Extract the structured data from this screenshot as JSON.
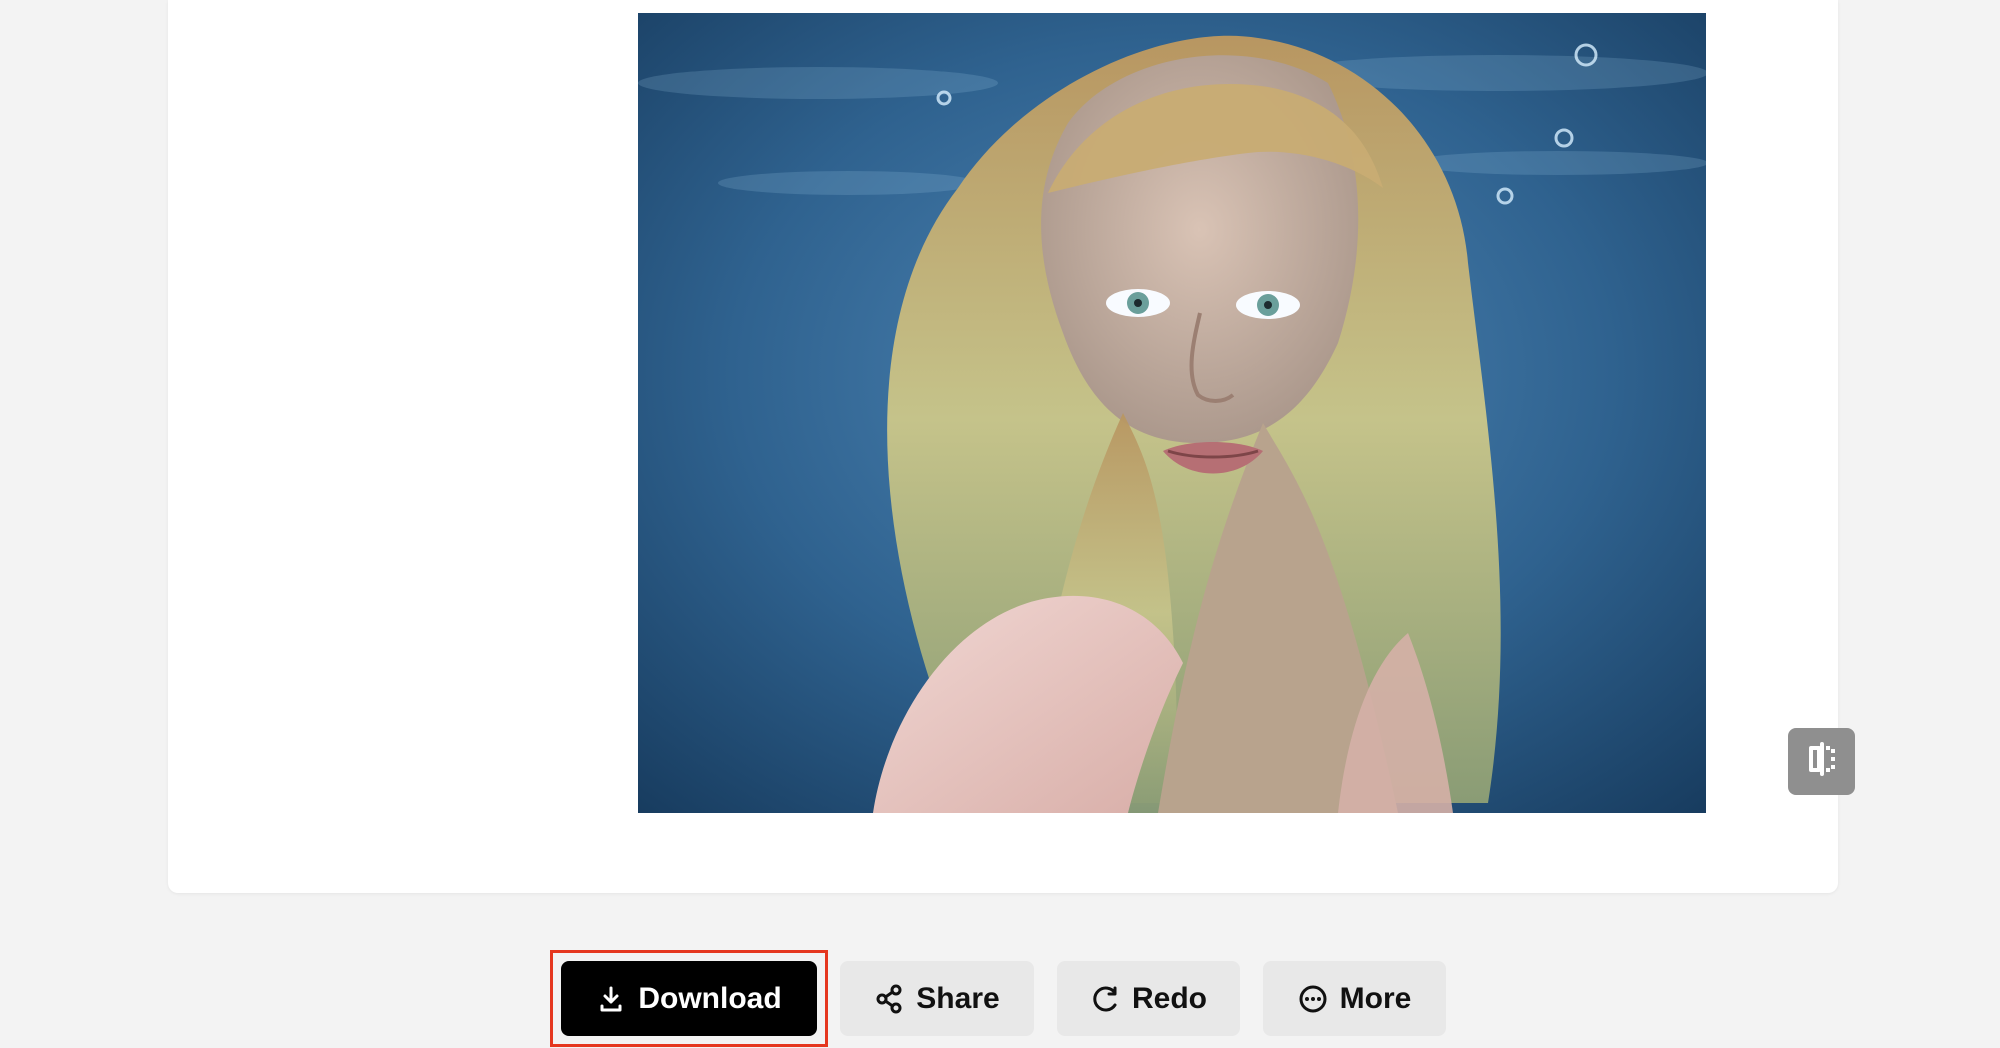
{
  "actions": {
    "download_label": "Download",
    "share_label": "Share",
    "redo_label": "Redo",
    "more_label": "More"
  },
  "image": {
    "description": "underwater portrait of a young woman with wavy blonde hair and lace top"
  },
  "icons": {
    "download": "download-icon",
    "share": "share-icon",
    "redo": "redo-icon",
    "more": "more-icon",
    "compare": "compare-icon"
  },
  "colors": {
    "primary": "#000000",
    "secondary": "#e8e8e8",
    "highlight": "#e5371f",
    "compare_button": "#8f8f8f"
  }
}
